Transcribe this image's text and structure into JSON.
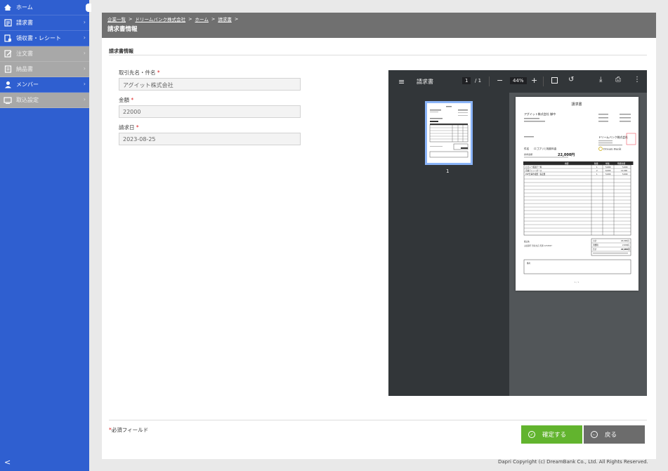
{
  "sidebar": {
    "items": [
      {
        "label": "ホーム",
        "icon": "home-icon",
        "state": "active"
      },
      {
        "label": "請求書",
        "icon": "invoice-icon",
        "state": "normal"
      },
      {
        "label": "領収書・レシート",
        "icon": "receipt-icon",
        "state": "normal"
      },
      {
        "label": "注文書",
        "icon": "order-icon",
        "state": "disabled"
      },
      {
        "label": "納品書",
        "icon": "delivery-icon",
        "state": "disabled"
      },
      {
        "label": "メンバー",
        "icon": "member-icon",
        "state": "normal"
      },
      {
        "label": "取込設定",
        "icon": "import-icon",
        "state": "disabled"
      }
    ],
    "collapse_glyph": "<"
  },
  "header": {
    "breadcrumb": [
      "企業一覧",
      "ドリームバンク株式会社",
      "ホーム",
      "請求書"
    ],
    "separator": ">",
    "title": "請求書情報"
  },
  "section": {
    "title": "請求書情報"
  },
  "form": {
    "client_label": "取引先名・件名",
    "client_value": "アグイット株式会社",
    "amount_label": "金額",
    "amount_value": "22000",
    "date_label": "請求日",
    "date_value": "2023-08-25",
    "required_mark": "*"
  },
  "viewer": {
    "title": "請求書",
    "page_current": "1",
    "page_total": "/ 1",
    "zoom": "44%",
    "thumb_number": "1",
    "page_footer": "1 / 1"
  },
  "invoice": {
    "heading": "請求書",
    "recipient": "アグイット株式会社 御中",
    "subject_label": "件名",
    "subject_value": "ロゴプリと相談料金",
    "total_label": "請求金額",
    "total_value": "22,000円",
    "issuer": "ドリームバンク株式会社",
    "brand": "Dream Bank",
    "table_headers": [
      "摘要",
      "数量",
      "単価",
      "明細金額"
    ],
    "rows": [
      [
        "ロゴシー相談チー料",
        "1",
        "5,000",
        "5,000"
      ],
      [
        "月額チャットボース",
        "2",
        "6,000",
        "12,000"
      ],
      [
        "PDF仕事作成費・指定費",
        "1",
        "5,000",
        "5,000"
      ]
    ],
    "subtotal_label": "小計",
    "subtotal_value": "20,000円",
    "tax_label": "消費税",
    "tax_value": "2,000円",
    "sum_label": "合計",
    "sum_value": "22,000円",
    "bank_label": "振込先",
    "bank_value": "山田銀行 渋谷支店 普通 1234567",
    "notes_label": "備考"
  },
  "footer": {
    "required_note": "必須フィールド",
    "confirm_label": "確定する",
    "back_label": "戻る",
    "copyright": "Dapri Copyright (c) DreamBank Co., Ltd. All Rights Reserved."
  },
  "colors": {
    "sidebar": "#2f5fd0",
    "header": "#707070",
    "confirm": "#62b42e",
    "back": "#6c6c6c",
    "required": "#d22222"
  }
}
